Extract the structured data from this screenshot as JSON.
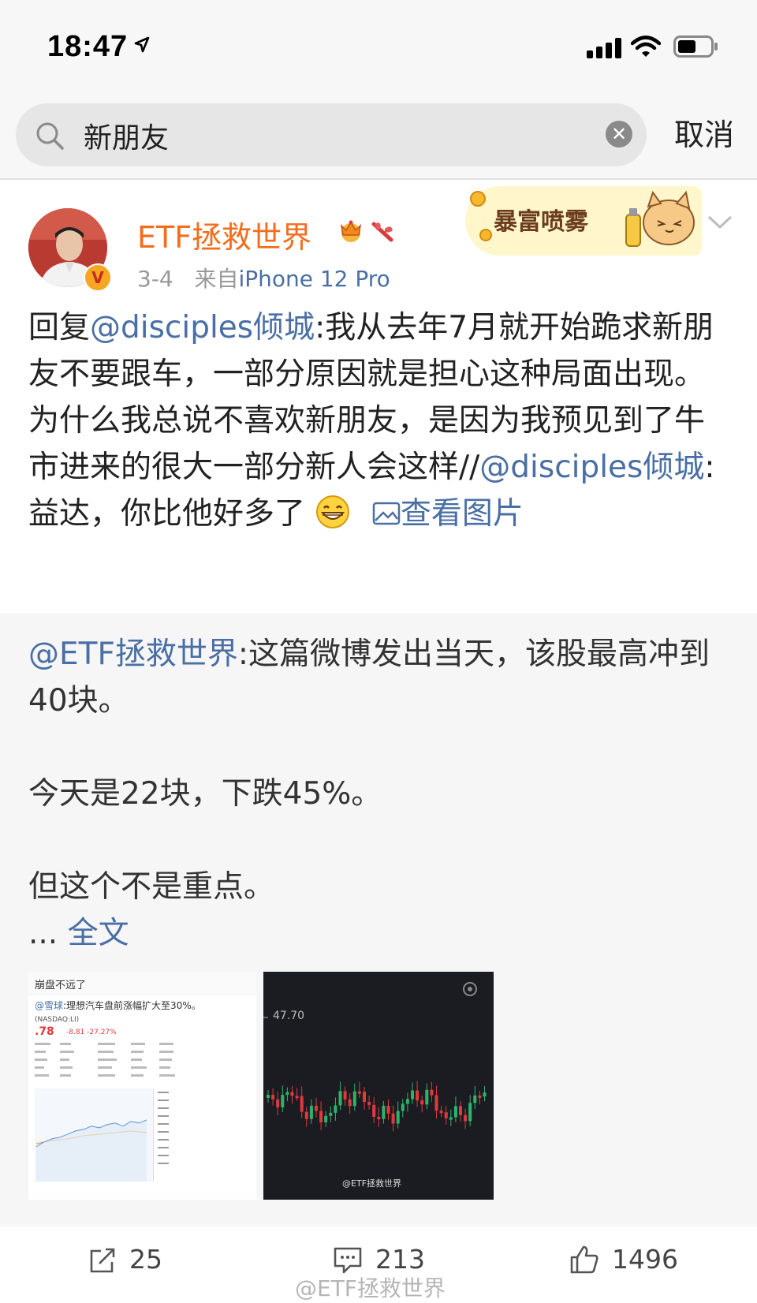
{
  "status_bar": {
    "time": "18:47"
  },
  "search": {
    "value": "新朋友",
    "cancel_label": "取消"
  },
  "post": {
    "author": "ETF拯救世界",
    "date": "3-4",
    "from_label": "来自",
    "device": "iPhone 12 Pro",
    "banner_text": "暴富喷雾",
    "body": {
      "reply_label": "回复",
      "mention_1": "@disciples倾城",
      "text_1": ":我从去年7月就开始跪求新朋友不要跟车，一部分原因就是担心这种局面出现。为什么我总说不喜欢新朋友，是因为我预见到了牛市进来的很大一部分新人会这样//",
      "mention_2": "@disciples倾城",
      "text_2": ":益达，你比他好多了",
      "view_image_label": "查看图片"
    },
    "repost": {
      "mention": "@ETF拯救世界",
      "line_1": ":这篇微博发出当天，该股最高冲到40块。",
      "line_2": "今天是22块，下跌45%。",
      "line_3": "但这个不是重点。",
      "ellipsis": "...",
      "full_text_label": "全文",
      "image_1": {
        "title": "崩盘不远了",
        "subtitle_mention": "@雪球",
        "subtitle": ":理想汽车盘前涨幅扩大至30%。",
        "ticker": "(NASDAQ:LI)",
        "price": ".78",
        "change": "-8.81 -27.27%"
      },
      "image_2": {
        "price_label": "47.70",
        "watermark": "@ETF拯救世界"
      }
    },
    "actions": {
      "reposts": "25",
      "comments": "213",
      "likes": "1496"
    },
    "watermark": "@ETF拯救世界"
  },
  "colors": {
    "username": "#f26d1d",
    "link": "#4a6fa5",
    "candle_up": "#2fb36b",
    "candle_down": "#e0393e"
  }
}
